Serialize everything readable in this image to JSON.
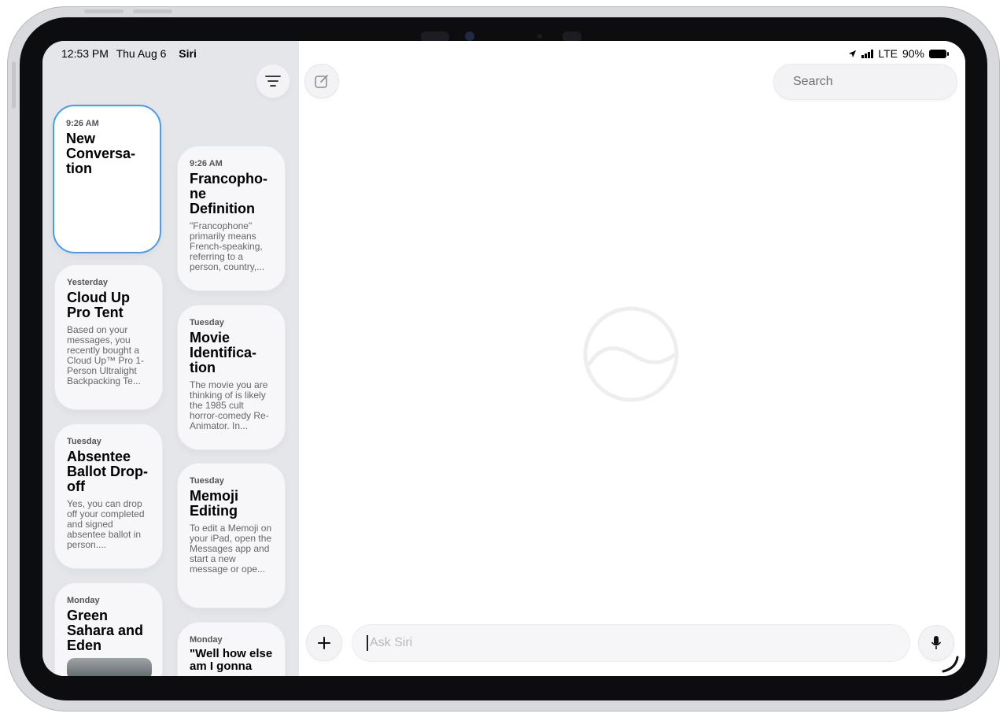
{
  "status_bar": {
    "time": "12:53 PM",
    "date": "Thu Aug 6",
    "app": "Siri",
    "network": "LTE",
    "battery": "90%"
  },
  "icons": {
    "filter": "filter-lines-icon",
    "compose": "compose-icon",
    "search": "magnifier-icon",
    "dictation": "microphone-icon",
    "add": "plus-icon",
    "location": "location-arrow-icon",
    "signal": "cellular-signal-icon",
    "battery": "battery-icon",
    "siri": "siri-orb-icon"
  },
  "colors": {
    "selected_border": "#4a9bec",
    "sidebar_bg": "#e5e6ea",
    "card_bg": "#f7f7f9"
  },
  "conversations": [
    {
      "date": "9:26 AM",
      "title": "New Conversa-tion",
      "preview": "",
      "selected": true
    },
    {
      "date": "9:26 AM",
      "title": "Francopho-ne Definition",
      "preview": "\"Francophone\" primarily means French-speaking, referring to a person, country,..."
    },
    {
      "date": "Yesterday",
      "title": "Cloud Up Pro Tent",
      "preview": "Based on your messages, you recently bought a Cloud Up™ Pro 1-Person Ultralight Backpacking Te..."
    },
    {
      "date": "Tuesday",
      "title": "Movie Identifica-tion",
      "preview": "The movie you are thinking of is likely the 1985 cult horror-comedy Re-Animator. In..."
    },
    {
      "date": "Tuesday",
      "title": "Absentee Ballot Drop-off",
      "preview": "Yes, you can drop off your completed and signed absentee ballot in person...."
    },
    {
      "date": "Tuesday",
      "title": "Memoji Editing",
      "preview": "To edit a Memoji on your iPad, open the Messages app and start a new message or ope..."
    },
    {
      "date": "Monday",
      "title": "Green Sahara and Eden",
      "preview": ""
    },
    {
      "date": "Monday",
      "title": "\"Well how else am I gonna",
      "preview": ""
    }
  ],
  "search": {
    "placeholder": "Search"
  },
  "composer": {
    "placeholder": "Ask Siri"
  }
}
